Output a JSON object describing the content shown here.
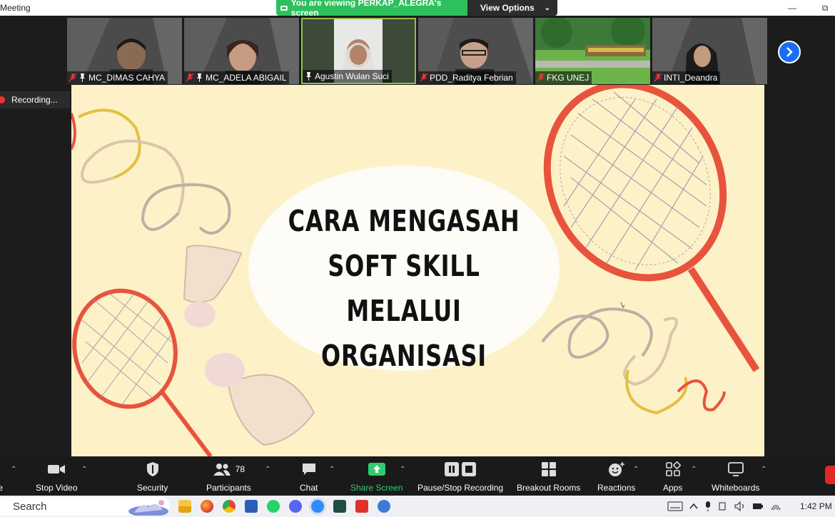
{
  "window": {
    "title": "Meeting",
    "viewing_banner": "You are viewing PERKAP_ALEGRA's screen",
    "view_options_label": "View Options"
  },
  "participants_strip": [
    {
      "name": "MC_DIMAS CAHYA",
      "muted": true,
      "pinned": true
    },
    {
      "name": "MC_ADELA ABIGAIL",
      "muted": true,
      "pinned": true
    },
    {
      "name": "Agustin Wulan Suci",
      "muted": false,
      "pinned": true,
      "active_speaker": true
    },
    {
      "name": "PDD_Raditya Febrian",
      "muted": true,
      "pinned": false
    },
    {
      "name": "FKG UNEJ",
      "muted": true,
      "pinned": false
    },
    {
      "name": "INTI_Deandra",
      "muted": true,
      "pinned": false
    }
  ],
  "recording": {
    "label": "Recording..."
  },
  "slide": {
    "title_lines": [
      "CARA MENGASAH",
      "SOFT SKILL MELALUI",
      "ORGANISASI"
    ]
  },
  "toolbar": {
    "mute_label": "te",
    "stop_video_label": "Stop Video",
    "security_label": "Security",
    "participants_label": "Participants",
    "participants_count": "78",
    "chat_label": "Chat",
    "share_screen_label": "Share Screen",
    "recording_label": "Pause/Stop Recording",
    "breakout_label": "Breakout Rooms",
    "reactions_label": "Reactions",
    "apps_label": "Apps",
    "whiteboards_label": "Whiteboards"
  },
  "taskbar": {
    "search_placeholder": "Search",
    "time": "1:42 PM"
  },
  "colors": {
    "slide_bg": "#fdf1c7",
    "racket": "#e8533d",
    "share_green": "#2ecc71",
    "banner_green": "#2ec05c",
    "accent_blue": "#1a6ef5"
  }
}
